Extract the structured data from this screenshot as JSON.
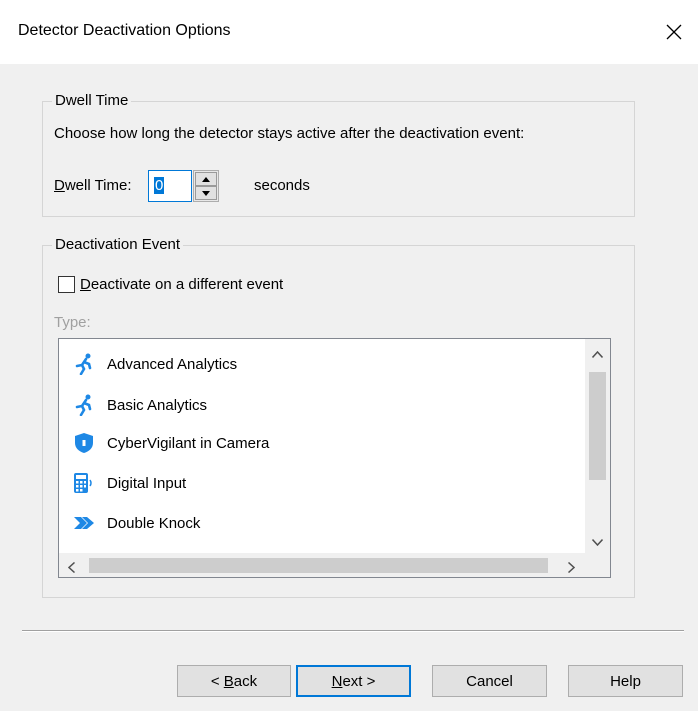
{
  "dialog": {
    "title": "Detector Deactivation Options"
  },
  "dwell": {
    "group_label": "Dwell Time",
    "description": "Choose how long the detector stays active after the deactivation event:",
    "label_mnemonic": "D",
    "label_rest": "well Time:",
    "value": "0",
    "unit": "seconds"
  },
  "deactivation": {
    "group_label": "Deactivation Event",
    "checkbox_mnemonic": "D",
    "checkbox_rest": "eactivate on a different event",
    "checkbox_checked": false,
    "type_label": "Type:",
    "items": [
      {
        "label": "Advanced Analytics",
        "icon": "running-person-icon"
      },
      {
        "label": "Basic Analytics",
        "icon": "running-person-icon"
      },
      {
        "label": "CyberVigilant in Camera",
        "icon": "shield-icon"
      },
      {
        "label": "Digital Input",
        "icon": "digital-input-icon"
      },
      {
        "label": "Double Knock",
        "icon": "double-arrow-icon"
      }
    ]
  },
  "buttons": {
    "back_pre": "< ",
    "back_mnemonic": "B",
    "back_rest": "ack",
    "next_mnemonic": "N",
    "next_rest": "ext >",
    "cancel": "Cancel",
    "help": "Help"
  },
  "colors": {
    "accent": "#0078d7",
    "icon_blue": "#1e88e5"
  }
}
